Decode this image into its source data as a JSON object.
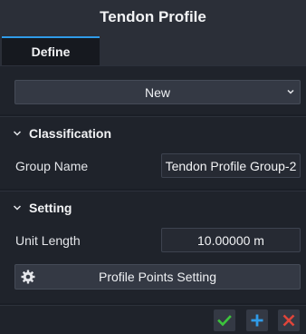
{
  "window": {
    "title": "Tendon Profile"
  },
  "tabs": [
    {
      "label": "Define",
      "active": true
    }
  ],
  "top": {
    "dropdown_value": "New"
  },
  "classification": {
    "header": "Classification",
    "group_name_label": "Group Name",
    "group_name_value": "Tendon Profile Group-2"
  },
  "setting": {
    "header": "Setting",
    "unit_length_label": "Unit Length",
    "unit_length_value": "10.00000 m",
    "profile_points_button": "Profile Points Setting"
  },
  "colors": {
    "accent": "#2f9be8",
    "confirm": "#3cc43c",
    "add": "#2f9be8",
    "cancel": "#e0453a"
  },
  "icons": [
    "chevron-down-icon",
    "gear-icon",
    "checkmark-icon",
    "plus-icon",
    "close-icon"
  ]
}
